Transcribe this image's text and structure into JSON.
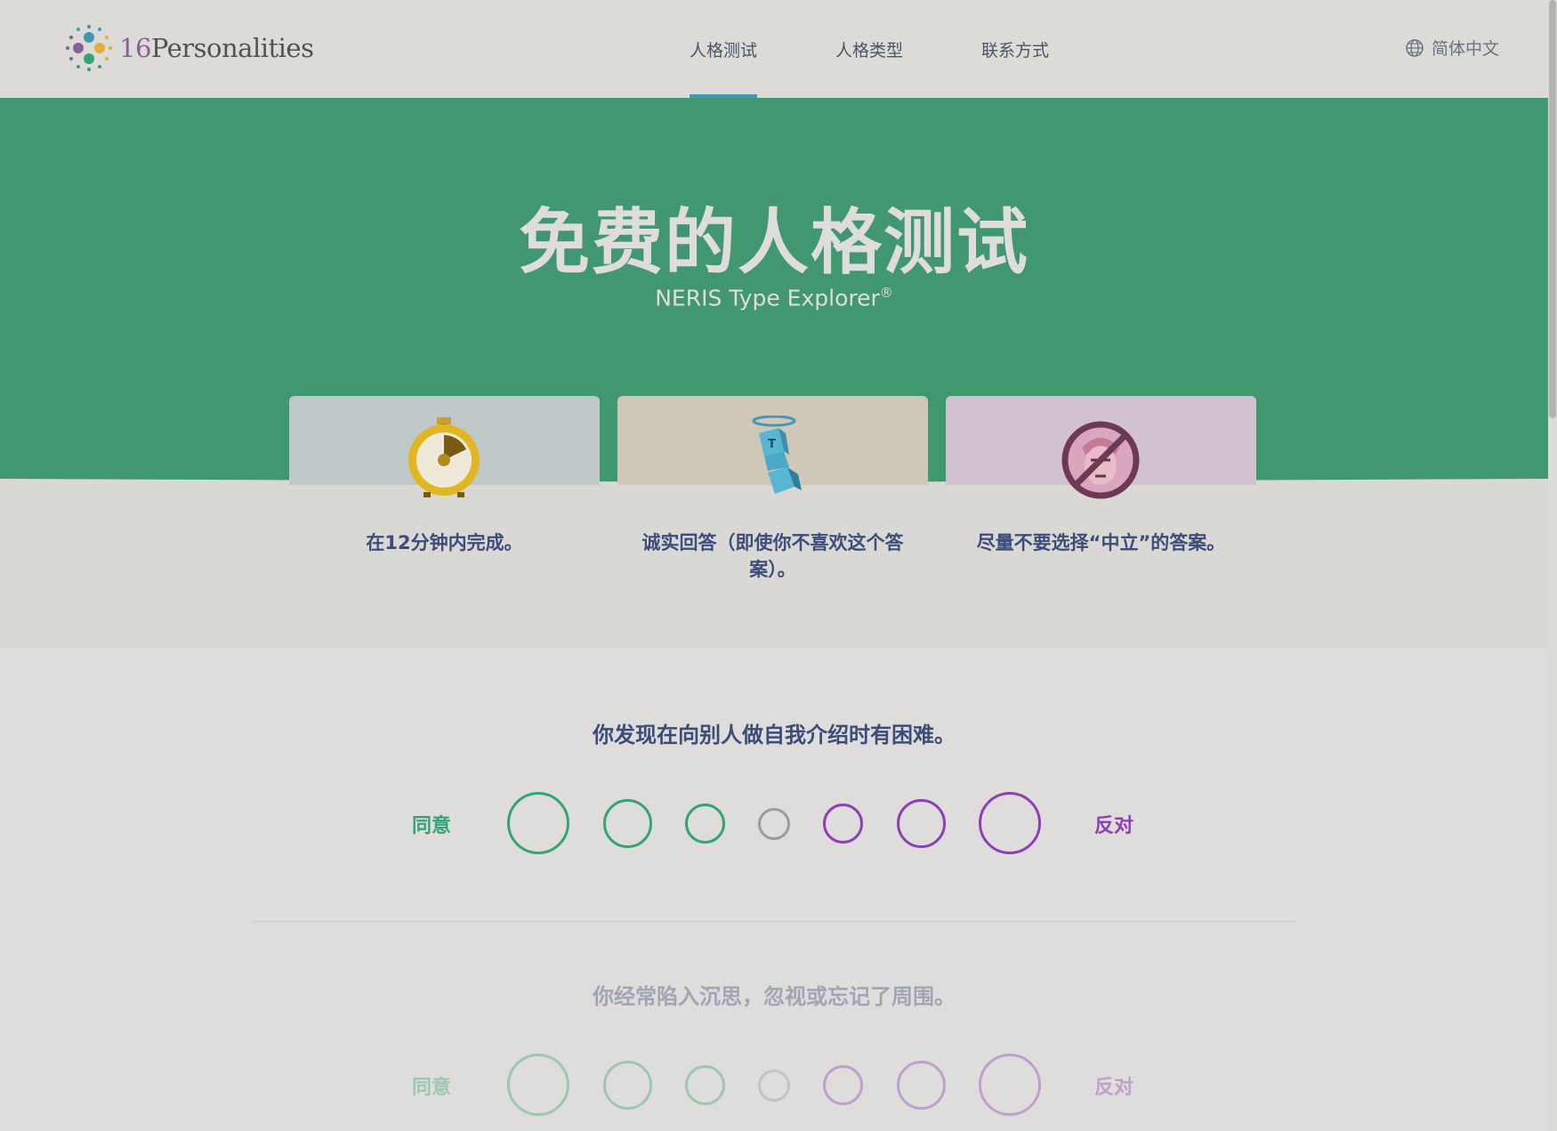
{
  "header": {
    "logo_num": "16",
    "logo_word": "Personalities",
    "nav": [
      "人格测试",
      "人格类型",
      "联系方式"
    ],
    "language": "简体中文"
  },
  "hero": {
    "title": "免费的人格测试",
    "subtitle": "NERIS Type Explorer",
    "registered": "®"
  },
  "cards": [
    {
      "icon": "stopwatch-icon",
      "text": "在12分钟内完成。",
      "color": "#bfc9ca"
    },
    {
      "icon": "honest-figure-icon",
      "text": "诚实回答（即使你不喜欢这个答案）。",
      "color": "#cfc7b7"
    },
    {
      "icon": "no-neutral-face-icon",
      "text": "尽量不要选择“中立”的答案。",
      "color": "#d2c1d0"
    }
  ],
  "questions": [
    {
      "text": "你发现在向别人做自我介绍时有困难。",
      "agree": "同意",
      "disagree": "反对"
    },
    {
      "text": "你经常陷入沉思，忽视或忘记了周围。",
      "agree": "同意",
      "disagree": "反对"
    }
  ],
  "colors": {
    "hero_green": "#41976f",
    "agree": "#33a474",
    "neutral": "#9b9b9b",
    "disagree": "#88619a",
    "disagree_ring": "#8f3fb5",
    "accent_underline": "#4298b4"
  }
}
